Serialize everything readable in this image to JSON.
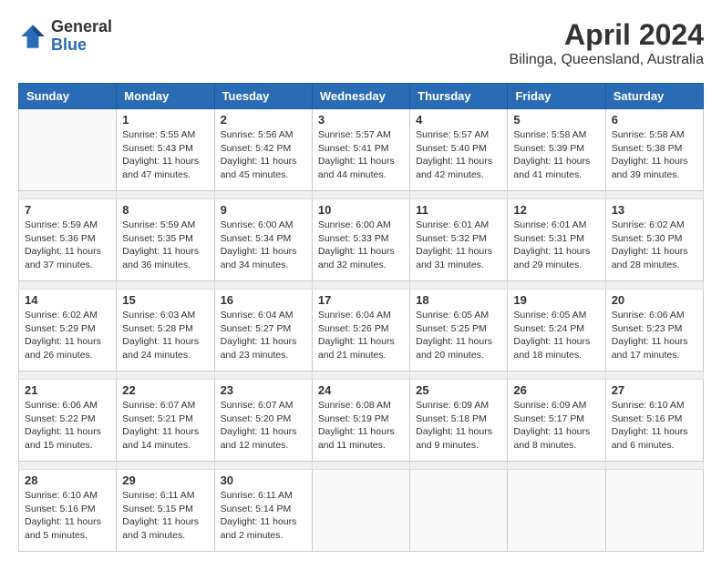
{
  "header": {
    "logo_general": "General",
    "logo_blue": "Blue",
    "month_title": "April 2024",
    "location": "Bilinga, Queensland, Australia"
  },
  "weekdays": [
    "Sunday",
    "Monday",
    "Tuesday",
    "Wednesday",
    "Thursday",
    "Friday",
    "Saturday"
  ],
  "weeks": [
    [
      {
        "day": "",
        "info": ""
      },
      {
        "day": "1",
        "info": "Sunrise: 5:55 AM\nSunset: 5:43 PM\nDaylight: 11 hours\nand 47 minutes."
      },
      {
        "day": "2",
        "info": "Sunrise: 5:56 AM\nSunset: 5:42 PM\nDaylight: 11 hours\nand 45 minutes."
      },
      {
        "day": "3",
        "info": "Sunrise: 5:57 AM\nSunset: 5:41 PM\nDaylight: 11 hours\nand 44 minutes."
      },
      {
        "day": "4",
        "info": "Sunrise: 5:57 AM\nSunset: 5:40 PM\nDaylight: 11 hours\nand 42 minutes."
      },
      {
        "day": "5",
        "info": "Sunrise: 5:58 AM\nSunset: 5:39 PM\nDaylight: 11 hours\nand 41 minutes."
      },
      {
        "day": "6",
        "info": "Sunrise: 5:58 AM\nSunset: 5:38 PM\nDaylight: 11 hours\nand 39 minutes."
      }
    ],
    [
      {
        "day": "7",
        "info": "Sunrise: 5:59 AM\nSunset: 5:36 PM\nDaylight: 11 hours\nand 37 minutes."
      },
      {
        "day": "8",
        "info": "Sunrise: 5:59 AM\nSunset: 5:35 PM\nDaylight: 11 hours\nand 36 minutes."
      },
      {
        "day": "9",
        "info": "Sunrise: 6:00 AM\nSunset: 5:34 PM\nDaylight: 11 hours\nand 34 minutes."
      },
      {
        "day": "10",
        "info": "Sunrise: 6:00 AM\nSunset: 5:33 PM\nDaylight: 11 hours\nand 32 minutes."
      },
      {
        "day": "11",
        "info": "Sunrise: 6:01 AM\nSunset: 5:32 PM\nDaylight: 11 hours\nand 31 minutes."
      },
      {
        "day": "12",
        "info": "Sunrise: 6:01 AM\nSunset: 5:31 PM\nDaylight: 11 hours\nand 29 minutes."
      },
      {
        "day": "13",
        "info": "Sunrise: 6:02 AM\nSunset: 5:30 PM\nDaylight: 11 hours\nand 28 minutes."
      }
    ],
    [
      {
        "day": "14",
        "info": "Sunrise: 6:02 AM\nSunset: 5:29 PM\nDaylight: 11 hours\nand 26 minutes."
      },
      {
        "day": "15",
        "info": "Sunrise: 6:03 AM\nSunset: 5:28 PM\nDaylight: 11 hours\nand 24 minutes."
      },
      {
        "day": "16",
        "info": "Sunrise: 6:04 AM\nSunset: 5:27 PM\nDaylight: 11 hours\nand 23 minutes."
      },
      {
        "day": "17",
        "info": "Sunrise: 6:04 AM\nSunset: 5:26 PM\nDaylight: 11 hours\nand 21 minutes."
      },
      {
        "day": "18",
        "info": "Sunrise: 6:05 AM\nSunset: 5:25 PM\nDaylight: 11 hours\nand 20 minutes."
      },
      {
        "day": "19",
        "info": "Sunrise: 6:05 AM\nSunset: 5:24 PM\nDaylight: 11 hours\nand 18 minutes."
      },
      {
        "day": "20",
        "info": "Sunrise: 6:06 AM\nSunset: 5:23 PM\nDaylight: 11 hours\nand 17 minutes."
      }
    ],
    [
      {
        "day": "21",
        "info": "Sunrise: 6:06 AM\nSunset: 5:22 PM\nDaylight: 11 hours\nand 15 minutes."
      },
      {
        "day": "22",
        "info": "Sunrise: 6:07 AM\nSunset: 5:21 PM\nDaylight: 11 hours\nand 14 minutes."
      },
      {
        "day": "23",
        "info": "Sunrise: 6:07 AM\nSunset: 5:20 PM\nDaylight: 11 hours\nand 12 minutes."
      },
      {
        "day": "24",
        "info": "Sunrise: 6:08 AM\nSunset: 5:19 PM\nDaylight: 11 hours\nand 11 minutes."
      },
      {
        "day": "25",
        "info": "Sunrise: 6:09 AM\nSunset: 5:18 PM\nDaylight: 11 hours\nand 9 minutes."
      },
      {
        "day": "26",
        "info": "Sunrise: 6:09 AM\nSunset: 5:17 PM\nDaylight: 11 hours\nand 8 minutes."
      },
      {
        "day": "27",
        "info": "Sunrise: 6:10 AM\nSunset: 5:16 PM\nDaylight: 11 hours\nand 6 minutes."
      }
    ],
    [
      {
        "day": "28",
        "info": "Sunrise: 6:10 AM\nSunset: 5:16 PM\nDaylight: 11 hours\nand 5 minutes."
      },
      {
        "day": "29",
        "info": "Sunrise: 6:11 AM\nSunset: 5:15 PM\nDaylight: 11 hours\nand 3 minutes."
      },
      {
        "day": "30",
        "info": "Sunrise: 6:11 AM\nSunset: 5:14 PM\nDaylight: 11 hours\nand 2 minutes."
      },
      {
        "day": "",
        "info": ""
      },
      {
        "day": "",
        "info": ""
      },
      {
        "day": "",
        "info": ""
      },
      {
        "day": "",
        "info": ""
      }
    ]
  ]
}
